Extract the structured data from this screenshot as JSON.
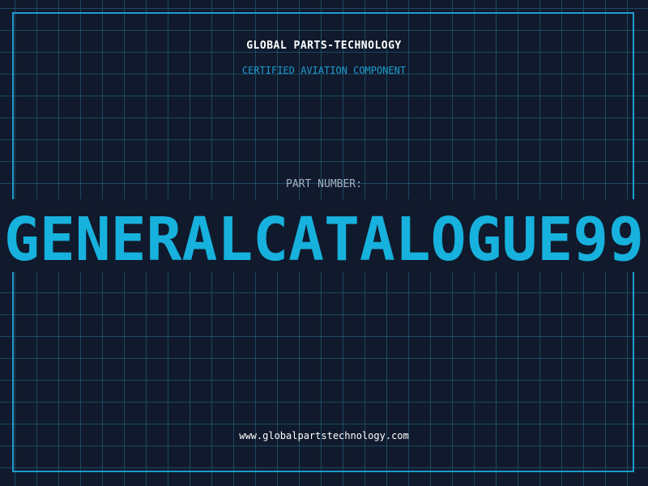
{
  "header": {
    "company": "GLOBAL PARTS-TECHNOLOGY",
    "subtitle": "CERTIFIED AVIATION COMPONENT"
  },
  "part": {
    "label": "PART NUMBER:",
    "number": "GENERALCATALOGUE99"
  },
  "footer": {
    "url": "www.globalpartstechnology.com"
  },
  "colors": {
    "background": "#101a2c",
    "grid": "#266e8c",
    "accent": "#1e9bd0",
    "part_number": "#17b1dd"
  }
}
